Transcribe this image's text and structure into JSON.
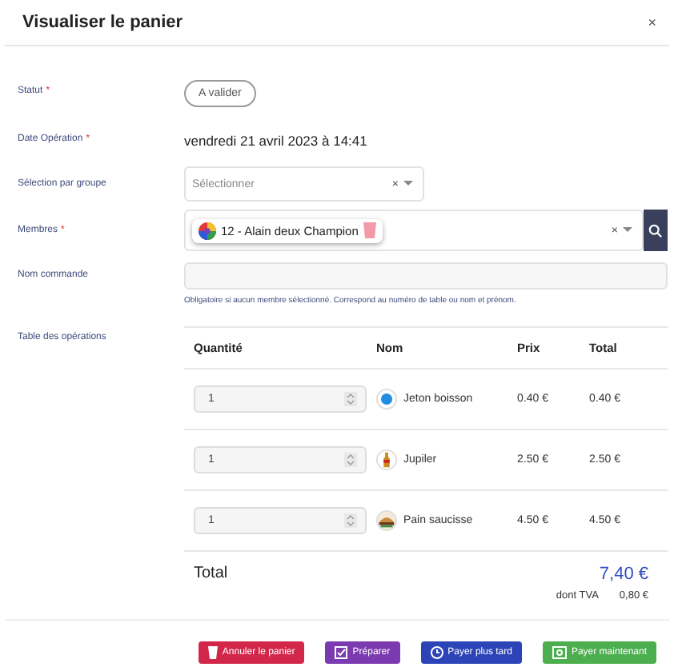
{
  "dialog": {
    "title": "Visualiser le panier",
    "close": "×"
  },
  "fields": [
    {
      "kind": "pill",
      "label": "Statut",
      "required_mark": "*",
      "value": "A valider"
    },
    {
      "kind": "text",
      "label": "Date Opération",
      "required_mark": "*",
      "value": "vendredi 21 avril 2023 à 14:41"
    },
    {
      "kind": "select",
      "label": "Sélection par groupe",
      "placeholder": "Sélectionner",
      "clear": "×"
    },
    {
      "kind": "member",
      "label": "Membres",
      "required_mark": "*",
      "value": "12 - Alain deux Champion",
      "clear": "×"
    },
    {
      "kind": "input",
      "label": "Nom commande",
      "hint": "Obligatoire si aucun membre sélectionné. Correspond au numéro de table ou nom et prénom."
    }
  ],
  "operations": {
    "label": "Table des opérations",
    "columns": [
      "Quantité",
      "Nom",
      "Prix",
      "Total"
    ],
    "rows": [
      {
        "quantity": "1",
        "kind": "token",
        "name": "Jeton boisson",
        "price": "0.40 €",
        "total": "0.40 €"
      },
      {
        "quantity": "1",
        "kind": "beer",
        "name": "Jupiler",
        "price": "2.50 €",
        "total": "2.50 €"
      },
      {
        "quantity": "1",
        "kind": "sandwich",
        "name": "Pain saucisse",
        "price": "4.50 €",
        "total": "4.50 €"
      }
    ],
    "total_label": "Total",
    "total": "7,40 €",
    "vat_label": "dont TVA",
    "vat": "0,80 €"
  },
  "buttons": [
    {
      "label": "Annuler le panier",
      "kind": "cancel",
      "color": "#d3264b"
    },
    {
      "label": "Préparer",
      "kind": "prepare",
      "color": "#7b3ab0"
    },
    {
      "label": "Payer plus tard",
      "kind": "later",
      "color": "#2c44b8"
    },
    {
      "label": "Payer maintenant",
      "kind": "pay",
      "color": "#4cae4f"
    }
  ]
}
